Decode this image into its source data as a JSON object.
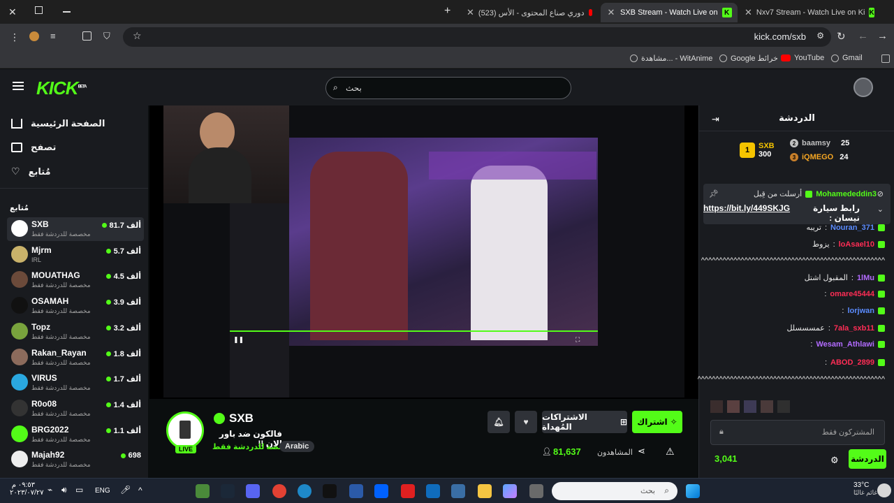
{
  "browser": {
    "tabs": [
      {
        "label": "Nxv7 Stream - Watch Live on Ki",
        "active": false
      },
      {
        "label": "SXB Stream - Watch Live on",
        "active": true
      },
      {
        "label": "(523) دوري صناع المحتوى - الأس",
        "active": false
      }
    ],
    "new_tab_label": "+",
    "url": "kick.com/sxb",
    "bookmarks": [
      "Gmail",
      "YouTube",
      "Google خرائط",
      "مشاهدة... - WitAnime"
    ]
  },
  "header": {
    "logo": "KICK",
    "logo_badge": "BETA",
    "search_placeholder": "بحث"
  },
  "leftnav": {
    "primary": [
      {
        "label": "الصفحة الرئيسية",
        "icon": "home-icon"
      },
      {
        "label": "تصفح",
        "icon": "browse-icon"
      },
      {
        "label": "مُتابع",
        "icon": "heart-icon"
      }
    ],
    "following_title": "مُتابع",
    "channels": [
      {
        "name": "SXB",
        "category": "مخصصة للدردشة فقط",
        "viewers": "81.7 ألف",
        "color": "#ffffff",
        "selected": true
      },
      {
        "name": "Mjrm",
        "category": "IRL",
        "viewers": "5.7 ألف",
        "color": "#c9b26a"
      },
      {
        "name": "MOUATHAG",
        "category": "مخصصة للدردشة فقط",
        "viewers": "4.5 ألف",
        "color": "#6b4a3a"
      },
      {
        "name": "OSAMAH",
        "category": "مخصصة للدردشة فقط",
        "viewers": "3.9 ألف",
        "color": "#111111"
      },
      {
        "name": "Topz",
        "category": "مخصصة للدردشة فقط",
        "viewers": "3.2 ألف",
        "color": "#79a33d"
      },
      {
        "name": "Rakan_Rayan",
        "category": "مخصصة للدردشة فقط",
        "viewers": "1.8 ألف",
        "color": "#8c6b5c"
      },
      {
        "name": "VIRUS",
        "category": "مخصصة للدردشة فقط",
        "viewers": "1.7 ألف",
        "color": "#2aa8e0"
      },
      {
        "name": "R0o08",
        "category": "مخصصة للدردشة فقط",
        "viewers": "1.4 ألف",
        "color": "#333333"
      },
      {
        "name": "BRG2022",
        "category": "مخصصة للدردشة فقط",
        "viewers": "1.1 ألف",
        "color": "#53fc18"
      },
      {
        "name": "Majah92",
        "category": "مخصصة للدردشة فقط",
        "viewers": "698",
        "color": "#eeeeee"
      }
    ]
  },
  "stream": {
    "channel": "SXB",
    "title": "فالكون ضد باور الان !!",
    "category": "مخصصة للدردشة فقط",
    "language": "Arabic",
    "live_label": "LIVE",
    "viewers": "81,637",
    "viewers_label": "المشاهدون",
    "subscribe_label": "اشتراك",
    "gift_label": "الاشتراكات المُهداة"
  },
  "chat": {
    "title": "الدردشة",
    "gifters": [
      {
        "rank": "1",
        "name": "SXB",
        "count": "300"
      },
      {
        "rank": "2",
        "name": "baamsy",
        "count": "25"
      },
      {
        "rank": "3",
        "name": "iQMEGO",
        "count": "24"
      }
    ],
    "pinned": {
      "user": "Mohamededdin3",
      "label": "أرسلت من قِبل",
      "text": "رابط سيارة نيسان :",
      "link": "https://bit.ly/449SKJG"
    },
    "messages": [
      {
        "user": "Nouran_371",
        "color": "#5b8cff",
        "text": "تريبه"
      },
      {
        "user": "loAsael10",
        "color": "#ff2d55",
        "text": "يزوط"
      },
      {
        "user": "",
        "color": "#eaeaea",
        "text": "^^^^^^^^^^^^^^^^^^^^^^^^^^^^^^^^^^^^^^^^^^^^^^^^^^^"
      },
      {
        "user": "1lMu",
        "color": "#b26bff",
        "text": "المقبول اشتل"
      },
      {
        "user": "omare45444",
        "color": "#ff2d55",
        "text": ""
      },
      {
        "user": "lorjwan",
        "color": "#5b8cff",
        "text": ""
      },
      {
        "user": "7ala_sxb11",
        "color": "#ff2d55",
        "text": "عمسسسلل"
      },
      {
        "user": "Wesam_Athlawi",
        "color": "#b26bff",
        "text": ""
      },
      {
        "user": "ABOD_2899",
        "color": "#ff2d55",
        "text": ""
      },
      {
        "user": "",
        "color": "#eaeaea",
        "text": "^^^^^^^^^^^^^^^^^^^^^^^^^^^^^^^^^^^^^^^^^^^^^^^^^^^^"
      }
    ],
    "input_placeholder": "المشتركون فقط",
    "points": "3,041",
    "send_label": "الدردشة"
  },
  "taskbar": {
    "search_placeholder": "بحث",
    "lang": "ENG",
    "weather": "33°C",
    "weather_label": "غائم غالبًا",
    "time": "٠٩:٥٣ م",
    "date": "٢٠٢٣/٠٧/٢٧"
  }
}
